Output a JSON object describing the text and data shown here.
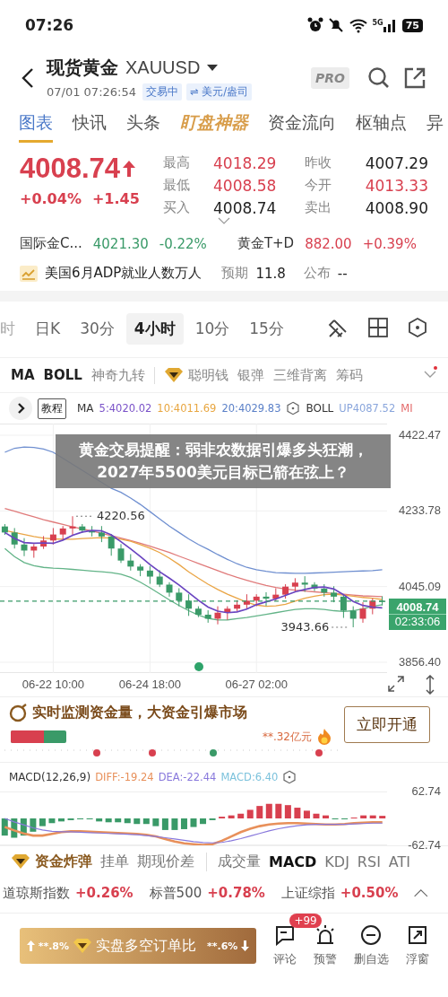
{
  "status_bar": {
    "time": "07:26",
    "network": "5G",
    "battery": "75"
  },
  "header": {
    "name": "现货黄金",
    "code": "XAUUSD",
    "datetime": "07/01 07:26:54",
    "tags": [
      "交易中",
      "⇌ 美元/盎司"
    ],
    "pro": "PRO"
  },
  "tabs": [
    {
      "label": "图表",
      "selected": true,
      "kind": "plain"
    },
    {
      "label": "快讯",
      "selected": false,
      "kind": "plain"
    },
    {
      "label": "头条",
      "selected": false,
      "kind": "plain"
    },
    {
      "label": "盯盘神器",
      "selected": false,
      "kind": "special"
    },
    {
      "label": "资金流向",
      "selected": false,
      "kind": "plain"
    },
    {
      "label": "枢轴点",
      "selected": false,
      "kind": "plain"
    },
    {
      "label": "异",
      "selected": false,
      "kind": "plain"
    }
  ],
  "quote": {
    "price": "4008.74",
    "rising": true,
    "color": "#d8404f",
    "change_pct": "+0.04%",
    "change": "+1.45",
    "stats": [
      {
        "label": "最高",
        "value": "4018.29",
        "color": "#d8404f"
      },
      {
        "label": "昨收",
        "value": "4007.29",
        "color": "#222222"
      },
      {
        "label": "最低",
        "value": "4008.58",
        "color": "#d8404f"
      },
      {
        "label": "今开",
        "value": "4013.33",
        "color": "#d8404f"
      },
      {
        "label": "买入",
        "value": "4008.74",
        "color": "#222222"
      },
      {
        "label": "卖出",
        "value": "4008.90",
        "color": "#222222"
      }
    ]
  },
  "related": [
    {
      "name": "国际金C...",
      "price": "4021.30",
      "change": "-0.22%",
      "color": "#3a9a68"
    },
    {
      "name": "黄金T+D",
      "price": "882.00",
      "change": "+0.39%",
      "color": "#d8404f"
    }
  ],
  "event": {
    "title": "美国6月ADP就业人数万人",
    "expected_label": "预期",
    "expected": "11.8",
    "published_label": "公布",
    "published": "--"
  },
  "periods": [
    {
      "label": "时",
      "selected": false
    },
    {
      "label": "日K",
      "selected": false
    },
    {
      "label": "30分",
      "selected": false
    },
    {
      "label": "4小时",
      "selected": true
    },
    {
      "label": "10分",
      "selected": false
    },
    {
      "label": "15分",
      "selected": false
    }
  ],
  "indicators": [
    {
      "label": "MA",
      "selected": true,
      "premium": false
    },
    {
      "label": "BOLL",
      "selected": true,
      "premium": false
    },
    {
      "label": "神奇九转",
      "selected": false,
      "premium": false
    },
    {
      "label": "聪明钱",
      "selected": false,
      "premium": true
    },
    {
      "label": "银弹",
      "selected": false,
      "premium": false
    },
    {
      "label": "三维背离",
      "selected": false,
      "premium": false
    },
    {
      "label": "筹码",
      "selected": false,
      "premium": false
    }
  ],
  "chart_info": {
    "tutorial": "教程",
    "ma_label": "MA",
    "ma": [
      {
        "text": "5:4020.02",
        "color": "#7a52c8"
      },
      {
        "text": "10:4011.69",
        "color": "#e8a640"
      },
      {
        "text": "20:4029.83",
        "color": "#5b80c8"
      }
    ],
    "boll_label": "BOLL",
    "boll": [
      {
        "text": "UP4087.52",
        "color": "#8aa6dc"
      },
      {
        "text": "MI",
        "color": "#e46a6a"
      }
    ]
  },
  "chart": {
    "high_mark": "4220.56",
    "low_mark": "3943.66",
    "last_price": "4008.74",
    "countdown": "02:33:06",
    "chart_data": {
      "type": "candlestick",
      "grid": true,
      "ylim": [
        3829.54,
        4451.56
      ],
      "categories": [
        null,
        null,
        null,
        null,
        null,
        "06-22 10:00",
        null,
        null,
        null,
        null,
        null,
        null,
        null,
        null,
        null,
        "06-24 18:00",
        null,
        null,
        null,
        null,
        null,
        null,
        null,
        null,
        null,
        null,
        "06-27 02:00",
        null,
        null,
        null,
        null,
        null,
        null,
        null,
        null,
        null,
        null,
        null,
        null,
        null
      ],
      "yticks": [
        4422.47,
        4233.78,
        4045.09,
        {
          "value": 3856.4,
          "label": "3856.40"
        }
      ],
      "ref_lines": [
        {
          "axis": "y",
          "value": 4008.74,
          "color": "#3a9a68"
        }
      ],
      "ohlc": [
        [
          4195,
          4201,
          4174,
          4180
        ],
        [
          4180,
          4191,
          4140,
          4150
        ],
        [
          4150,
          4166,
          4121,
          4135
        ],
        [
          4135,
          4151,
          4117,
          4145
        ],
        [
          4145,
          4171,
          4139,
          4160
        ],
        [
          4160,
          4191,
          4150,
          4175
        ],
        [
          4175,
          4196,
          4161,
          4190
        ],
        [
          4190,
          4220.56,
          4172,
          4195
        ],
        [
          4195,
          4201,
          4179,
          4185
        ],
        [
          4185,
          4196,
          4170,
          4180
        ],
        [
          4180,
          4196,
          4156,
          4170
        ],
        [
          4170,
          4176,
          4122,
          4140
        ],
        [
          4140,
          4151,
          4104,
          4110
        ],
        [
          4110,
          4126,
          4085,
          4095
        ],
        [
          4095,
          4101,
          4071,
          4085
        ],
        [
          4085,
          4096,
          4052,
          4070
        ],
        [
          4070,
          4086,
          4044,
          4050
        ],
        [
          4050,
          4056,
          4020,
          4030
        ],
        [
          4030,
          4041,
          3996,
          4010
        ],
        [
          4010,
          4026,
          3972,
          3990
        ],
        [
          3990,
          3996,
          3969,
          3975
        ],
        [
          3975,
          3986,
          3955,
          3965
        ],
        [
          3965,
          3996,
          3951,
          3980
        ],
        [
          3980,
          3996,
          3962,
          3990
        ],
        [
          3990,
          4011,
          3984,
          4000
        ],
        [
          4000,
          4026,
          3990,
          4010
        ],
        [
          4010,
          4026,
          3996,
          4020
        ],
        [
          4020,
          4031,
          3997,
          4015
        ],
        [
          4015,
          4041,
          4009,
          4025
        ],
        [
          4025,
          4051,
          4015,
          4045
        ],
        [
          4045,
          4066,
          4031,
          4055
        ],
        [
          4055,
          4071,
          4032,
          4050
        ],
        [
          4050,
          4056,
          4034,
          4040
        ],
        [
          4040,
          4051,
          4020,
          4030
        ],
        [
          4030,
          4046,
          4006,
          4020
        ],
        [
          4020,
          4026,
          3967,
          3985
        ],
        [
          3985,
          3996,
          3943.66,
          3965
        ],
        [
          3965,
          4006,
          3955,
          3990
        ],
        [
          3990,
          4016,
          3976,
          4010
        ],
        [
          4010,
          4021,
          3998,
          4008.74
        ]
      ],
      "series": [
        {
          "type": "line",
          "color": "#6f8fd0",
          "values": [
            4380,
            4390,
            4393,
            4392,
            4388,
            4380,
            null,
            null,
            null,
            null,
            null,
            4290,
            4280,
            4266,
            4250,
            4232,
            4214,
            4196,
            4180,
            4164,
            4150,
            4138,
            4125,
            4113,
            4102,
            4093,
            4087,
            4083,
            4080,
            4079,
            4078,
            4078,
            4079,
            4080,
            4081,
            4082,
            4083,
            4084,
            4085,
            4087
          ]
        },
        {
          "type": "line",
          "color": "#63b488",
          "values": [
            4140,
            4120,
            4105,
            4097,
            4093,
            4091,
            4090,
            4088,
            4086,
            4084,
            4082,
            4080,
            4076,
            4068,
            4056,
            4042,
            4027,
            4012,
            3998,
            3985,
            3974,
            3966,
            3962,
            3962,
            3965,
            3968,
            3972,
            3976,
            3980,
            3984,
            3988,
            3990,
            3990,
            3988,
            3985,
            3983,
            3985,
            3990,
            3996,
            4000
          ]
        },
        {
          "type": "line",
          "color": "#e07a7a",
          "values": [
            4240,
            4233,
            4226,
            4219,
            4212,
            4206,
            4200,
            4194,
            4189,
            4184,
            4178,
            4172,
            4166,
            4160,
            4153,
            4146,
            4138,
            4130,
            4121,
            4112,
            4103,
            4094,
            4085,
            4076,
            4068,
            4061,
            4054,
            4048,
            4043,
            4039,
            4036,
            4034,
            4032,
            4030,
            4028,
            4026,
            4024,
            4022,
            4021,
            4020
          ]
        },
        {
          "type": "line",
          "color": "#eaa545",
          "values": [
            4185,
            4180,
            4175,
            4170,
            4166,
            4164,
            4163,
            4163,
            4165,
            4166,
            4167,
            4166,
            4163,
            4158,
            4150,
            4141,
            4130,
            4116,
            4100,
            4082,
            4066,
            4051,
            4038,
            4026,
            4016,
            4006,
            3999,
            3996,
            3997,
            4001,
            4009,
            4016,
            4021,
            4025,
            4026,
            4024,
            4021,
            4018,
            4016,
            4013
          ]
        },
        {
          "type": "line",
          "color": "#6a45c0",
          "values": [
            4180,
            4165,
            4155,
            4153,
            4154,
            4153,
            4161,
            4173,
            4181,
            4185,
            4184,
            4174,
            4157,
            4139,
            4120,
            4100,
            4082,
            4066,
            4049,
            4030,
            4011,
            3994,
            3984,
            3980,
            3982,
            3989,
            4000,
            4007,
            4014,
            4023,
            4032,
            4038,
            4043,
            4044,
            4039,
            4025,
            4008,
            3998,
            3994,
            3992
          ]
        }
      ]
    }
  },
  "banner": {
    "text": "黄金交易提醒：弱非农数据引爆多头狂潮，2027年5500美元目标已箭在弦上？"
  },
  "fund_monitor": {
    "title": "实时监测资金量，大资金引爆市场",
    "amount": "**.32亿元",
    "button": "立即开通",
    "level": 0.6
  },
  "macd": {
    "label": "MACD(12,26,9)",
    "values": [
      {
        "text": "DIFF:-19.24",
        "color": "#e8905a"
      },
      {
        "text": "DEA:-22.44",
        "color": "#8878dc"
      },
      {
        "text": "MACD:6.40",
        "color": "#7cc2dc"
      }
    ],
    "chart_data": {
      "type": "bar",
      "ylim": [
        -62.74,
        62.74
      ],
      "yticks": [
        62.74,
        -62.74
      ],
      "series": [
        {
          "values": [
            -40,
            -45,
            -40,
            -31,
            -18,
            -11,
            -7,
            -4,
            -2,
            -2,
            -7,
            -9,
            -9,
            -11,
            -13,
            -13,
            -18,
            -27,
            -27,
            -25,
            -20,
            -13,
            -4,
            4,
            7,
            11,
            20,
            29,
            34,
            34,
            31,
            25,
            18,
            11,
            7,
            -2,
            -2,
            2,
            7,
            7,
            6
          ],
          "colors": [
            "#3a9a68",
            "#3a9a68",
            "#3a9a68",
            "#3a9a68",
            "#3a9a68",
            "#3a9a68",
            "#3a9a68",
            "#3a9a68",
            "#3a9a68",
            "#3a9a68",
            "#3a9a68",
            "#3a9a68",
            "#3a9a68",
            "#3a9a68",
            "#3a9a68",
            "#3a9a68",
            "#3a9a68",
            "#3a9a68",
            "#3a9a68",
            "#3a9a68",
            "#3a9a68",
            "#3a9a68",
            "#3a9a68",
            "#d8404f",
            "#d8404f",
            "#d8404f",
            "#d8404f",
            "#d8404f",
            "#d8404f",
            "#d8404f",
            "#d8404f",
            "#d8404f",
            "#d8404f",
            "#d8404f",
            "#d8404f",
            "#3a9a68",
            "#3a9a68",
            "#d8404f",
            "#d8404f",
            "#d8404f",
            "#d8404f"
          ]
        },
        {
          "type": "line",
          "color": "#e8905a",
          "values": [
            -20,
            -28,
            -35,
            -40,
            -40,
            -36,
            -32,
            -30,
            -30,
            -31,
            -32,
            -33,
            -34,
            -35,
            -36,
            -38,
            -42,
            -48,
            -54,
            -58,
            -60,
            -62,
            -60,
            -52,
            -42,
            -32,
            -24,
            -18,
            -14,
            -12,
            -11,
            -11,
            -12,
            -13,
            -14,
            -14,
            -13,
            -11,
            -10,
            -9,
            -9
          ]
        },
        {
          "type": "line",
          "color": "#8878dc",
          "values": [
            0,
            -8,
            -15,
            -22,
            -27,
            -30,
            -31,
            -31,
            -32,
            -33,
            -34,
            -35,
            -36,
            -37,
            -38,
            -40,
            -42,
            -45,
            -48,
            -51,
            -54,
            -56,
            -57,
            -56,
            -52,
            -47,
            -41,
            -35,
            -29,
            -24,
            -20,
            -17,
            -15,
            -14,
            -14,
            -14,
            -14,
            -13,
            -12,
            -11,
            -11
          ]
        }
      ]
    }
  },
  "sub_indicators": [
    {
      "label": "资金炸弹",
      "selected": false,
      "premium": true,
      "divider_before": false
    },
    {
      "label": "挂单",
      "selected": false,
      "premium": false,
      "divider_before": false
    },
    {
      "label": "期现价差",
      "selected": false,
      "premium": false,
      "divider_before": false
    },
    {
      "label": "成交量",
      "selected": false,
      "premium": false,
      "divider_before": true
    },
    {
      "label": "MACD",
      "selected": true,
      "premium": false,
      "divider_before": false
    },
    {
      "label": "KDJ",
      "selected": false,
      "premium": false,
      "divider_before": false
    },
    {
      "label": "RSI",
      "selected": false,
      "premium": false,
      "divider_before": false
    },
    {
      "label": "ATI",
      "selected": false,
      "premium": false,
      "divider_before": false
    }
  ],
  "tickers": [
    {
      "name": "道琼斯指数",
      "change": "+0.26%"
    },
    {
      "name": "标普500",
      "change": "+0.78%"
    },
    {
      "name": "上证综指",
      "change": "+0.50%"
    }
  ],
  "bottom": {
    "long": "**.8%",
    "ratio_label": "实盘多空订单比",
    "short": "**.6%",
    "actions": [
      {
        "label": "评论",
        "badge": "+99"
      },
      {
        "label": "预警"
      },
      {
        "label": "删自选"
      },
      {
        "label": "浮窗"
      }
    ]
  }
}
